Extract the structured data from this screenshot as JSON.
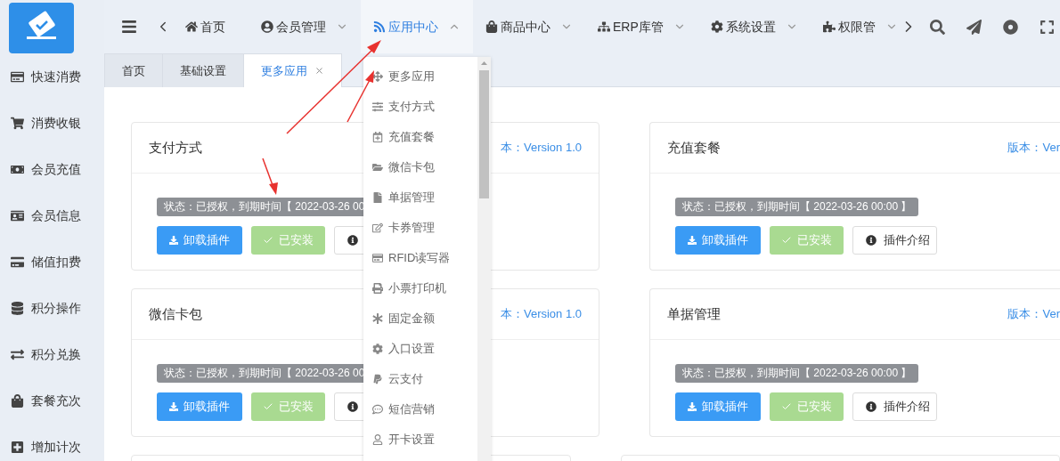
{
  "sidebar": {
    "items": [
      {
        "label": "快速消费"
      },
      {
        "label": "消费收银"
      },
      {
        "label": "会员充值"
      },
      {
        "label": "会员信息"
      },
      {
        "label": "储值扣费"
      },
      {
        "label": "积分操作"
      },
      {
        "label": "积分兑换"
      },
      {
        "label": "套餐充次"
      },
      {
        "label": "增加计次"
      }
    ]
  },
  "nav": {
    "items": [
      {
        "label": "首页",
        "selected": false
      },
      {
        "label": "会员管理",
        "selected": false,
        "expanded": false
      },
      {
        "label": "应用中心",
        "selected": true,
        "expanded": true
      },
      {
        "label": "商品中心",
        "selected": false,
        "expanded": false
      },
      {
        "label": "ERP库管",
        "selected": false,
        "expanded": false
      },
      {
        "label": "系统设置",
        "selected": false,
        "expanded": false
      },
      {
        "label": "权限管",
        "selected": false,
        "expanded": false
      }
    ]
  },
  "tabs": [
    {
      "label": "首页",
      "selected": false
    },
    {
      "label": "基础设置",
      "selected": false
    },
    {
      "label": "更多应用",
      "selected": true,
      "closable": true
    }
  ],
  "dropdown": {
    "items": [
      {
        "label": "更多应用"
      },
      {
        "label": "支付方式"
      },
      {
        "label": "充值套餐"
      },
      {
        "label": "微信卡包"
      },
      {
        "label": "单据管理"
      },
      {
        "label": "卡券管理"
      },
      {
        "label": "RFID读写器"
      },
      {
        "label": "小票打印机"
      },
      {
        "label": "固定金额"
      },
      {
        "label": "入口设置"
      },
      {
        "label": "云支付"
      },
      {
        "label": "短信营销"
      },
      {
        "label": "开卡设置"
      }
    ]
  },
  "cards": [
    {
      "title": "支付方式",
      "version": "本：Version 1.0",
      "status": "状态：已授权，到期时间【 2022-03-26 00",
      "uninstall": "卸载插件",
      "installed": "已安装"
    },
    {
      "title": "充值套餐",
      "version": "版本：Ver",
      "status": "状态：已授权，到期时间【 2022-03-26 00:00 】",
      "uninstall": "卸载插件",
      "installed": "已安装",
      "intro": "插件介绍"
    },
    {
      "title": "微信卡包",
      "version": "本：Version 1.0",
      "status": "状态：已授权，到期时间【 2022-03-26 00",
      "uninstall": "卸载插件",
      "installed": "已安装"
    },
    {
      "title": "单据管理",
      "version": "版本：Ver",
      "status": "状态：已授权，到期时间【 2022-03-26 00:00 】",
      "uninstall": "卸载插件",
      "installed": "已安装",
      "intro": "插件介绍"
    }
  ]
}
